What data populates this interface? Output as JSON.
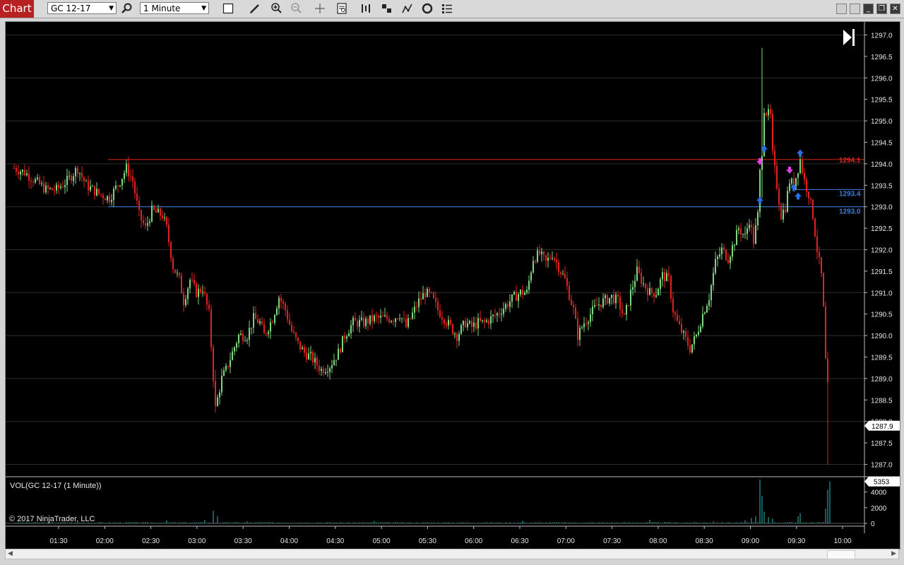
{
  "toolbar": {
    "title": "Chart",
    "instrument": "GC 12-17",
    "interval": "1 Minute",
    "icons": [
      "search-icon",
      "chart-style-icon",
      "pencil-icon",
      "zoom-in-icon",
      "zoom-out-icon",
      "crosshair-icon",
      "data-box-icon",
      "bar-spacing-icon",
      "bar-width-icon",
      "indicators-icon",
      "strategies-icon",
      "properties-icon"
    ]
  },
  "colors": {
    "up": "#7ed67e",
    "down": "#e0231e",
    "accent": "#b72121",
    "level_red": "#e0231e",
    "level_blue": "#3a7ee0",
    "volume": "#2fb7b7"
  },
  "chart_data": {
    "type": "candlestick",
    "instrument": "GC 12-17",
    "interval": "1 Minute",
    "y_ticks": [
      1297.0,
      1296.5,
      1296.0,
      1295.5,
      1295.0,
      1294.5,
      1294.0,
      1293.5,
      1293.0,
      1292.5,
      1292.0,
      1291.5,
      1291.0,
      1290.5,
      1290.0,
      1289.5,
      1289.0,
      1288.5,
      1288.0,
      1287.5,
      1287.0
    ],
    "ylim": [
      1286.85,
      1297.2
    ],
    "x_labels": [
      "01:30",
      "02:00",
      "02:30",
      "03:00",
      "03:30",
      "04:00",
      "04:30",
      "05:00",
      "05:30",
      "06:00",
      "06:30",
      "07:00",
      "07:30",
      "08:00",
      "08:30",
      "09:00",
      "09:30",
      "10:00"
    ],
    "last_price": "1287.9",
    "levels": [
      {
        "label": "1294.1",
        "value": 1294.1,
        "color": "red"
      },
      {
        "label": "1293.4",
        "value": 1293.4,
        "color": "blue"
      },
      {
        "label": "1293.0",
        "value": 1293.0,
        "color": "blue"
      }
    ],
    "path": [
      [
        0,
        1293.9
      ],
      [
        5,
        1293.8
      ],
      [
        10,
        1293.6
      ],
      [
        15,
        1293.4
      ],
      [
        20,
        1293.4
      ],
      [
        25,
        1293.6
      ],
      [
        30,
        1293.9
      ],
      [
        34,
        1293.5
      ],
      [
        40,
        1293.3
      ],
      [
        45,
        1293.2
      ],
      [
        50,
        1293.6
      ],
      [
        53,
        1293.9
      ],
      [
        56,
        1293.6
      ],
      [
        59,
        1292.8
      ],
      [
        62,
        1292.5
      ],
      [
        65,
        1292.9
      ],
      [
        70,
        1292.8
      ],
      [
        72,
        1292.5
      ],
      [
        75,
        1291.6
      ],
      [
        78,
        1291.3
      ],
      [
        80,
        1290.8
      ],
      [
        83,
        1291.3
      ],
      [
        86,
        1291.0
      ],
      [
        89,
        1291.1
      ],
      [
        92,
        1290.5
      ],
      [
        95,
        1288.3
      ],
      [
        98,
        1289.0
      ],
      [
        100,
        1289.2
      ],
      [
        103,
        1289.6
      ],
      [
        106,
        1290.0
      ],
      [
        110,
        1290.0
      ],
      [
        113,
        1290.4
      ],
      [
        116,
        1290.3
      ],
      [
        118,
        1290.0
      ],
      [
        122,
        1290.4
      ],
      [
        125,
        1290.9
      ],
      [
        128,
        1290.6
      ],
      [
        131,
        1290.1
      ],
      [
        134,
        1289.8
      ],
      [
        137,
        1289.6
      ],
      [
        140,
        1289.5
      ],
      [
        145,
        1289.2
      ],
      [
        149,
        1289.3
      ],
      [
        153,
        1289.6
      ],
      [
        156,
        1290.0
      ],
      [
        160,
        1290.3
      ],
      [
        165,
        1290.3
      ],
      [
        170,
        1290.4
      ],
      [
        175,
        1290.4
      ],
      [
        179,
        1290.4
      ],
      [
        182,
        1290.5
      ],
      [
        185,
        1290.2
      ],
      [
        188,
        1290.5
      ],
      [
        191,
        1290.8
      ],
      [
        194,
        1291.0
      ],
      [
        197,
        1290.9
      ],
      [
        200,
        1290.6
      ],
      [
        203,
        1290.4
      ],
      [
        206,
        1290.2
      ],
      [
        209,
        1290.0
      ],
      [
        213,
        1290.3
      ],
      [
        216,
        1290.2
      ],
      [
        219,
        1290.3
      ],
      [
        222,
        1290.3
      ],
      [
        225,
        1290.4
      ],
      [
        228,
        1290.5
      ],
      [
        232,
        1290.7
      ],
      [
        236,
        1290.9
      ],
      [
        239,
        1291.0
      ],
      [
        242,
        1291.0
      ],
      [
        245,
        1291.8
      ],
      [
        248,
        1291.9
      ],
      [
        251,
        1291.7
      ],
      [
        254,
        1291.9
      ],
      [
        257,
        1291.6
      ],
      [
        260,
        1291.3
      ],
      [
        264,
        1290.6
      ],
      [
        266,
        1290.0
      ],
      [
        269,
        1290.3
      ],
      [
        272,
        1290.5
      ],
      [
        275,
        1290.7
      ],
      [
        278,
        1290.8
      ],
      [
        282,
        1290.9
      ],
      [
        285,
        1290.8
      ],
      [
        288,
        1290.4
      ],
      [
        291,
        1291.0
      ],
      [
        294,
        1291.5
      ],
      [
        297,
        1291.2
      ],
      [
        300,
        1291.0
      ],
      [
        303,
        1291.0
      ],
      [
        306,
        1291.4
      ],
      [
        309,
        1291.3
      ],
      [
        311,
        1290.6
      ],
      [
        313,
        1290.3
      ],
      [
        316,
        1290.0
      ],
      [
        319,
        1289.7
      ],
      [
        322,
        1290.0
      ],
      [
        325,
        1290.5
      ],
      [
        328,
        1290.9
      ],
      [
        331,
        1291.7
      ],
      [
        334,
        1292.0
      ],
      [
        337,
        1291.8
      ],
      [
        340,
        1292.2
      ],
      [
        342,
        1292.5
      ],
      [
        345,
        1292.3
      ],
      [
        347,
        1292.7
      ],
      [
        349,
        1292.2
      ],
      [
        351,
        1292.8
      ],
      [
        352,
        1293.8
      ],
      [
        353,
        1294.3
      ],
      [
        354,
        1295.3
      ],
      [
        355,
        1295.2
      ],
      [
        357,
        1295.1
      ],
      [
        358,
        1294.2
      ],
      [
        360,
        1293.5
      ],
      [
        362,
        1292.8
      ],
      [
        364,
        1293.0
      ],
      [
        366,
        1293.6
      ],
      [
        368,
        1293.5
      ],
      [
        370,
        1293.9
      ],
      [
        371,
        1294.1
      ],
      [
        373,
        1293.6
      ],
      [
        375,
        1293.3
      ],
      [
        377,
        1292.8
      ],
      [
        379,
        1292.0
      ],
      [
        381,
        1291.4
      ],
      [
        382,
        1290.6
      ],
      [
        383,
        1289.4
      ],
      [
        384,
        1288.8
      ],
      [
        385,
        1287.9
      ]
    ],
    "volume": {
      "label": "VOL(GC 12-17 (1 Minute))",
      "last": "5353",
      "ticks": [
        "4000",
        "2000",
        "0"
      ],
      "ylim": [
        0,
        5600
      ],
      "spikes": [
        [
          72,
          380
        ],
        [
          90,
          420
        ],
        [
          94,
          1600
        ],
        [
          96,
          900
        ],
        [
          110,
          260
        ],
        [
          170,
          300
        ],
        [
          240,
          330
        ],
        [
          300,
          450
        ],
        [
          330,
          260
        ],
        [
          345,
          400
        ],
        [
          348,
          700
        ],
        [
          350,
          900
        ],
        [
          352,
          5600
        ],
        [
          353,
          3500
        ],
        [
          354,
          1500
        ],
        [
          356,
          800
        ],
        [
          358,
          600
        ],
        [
          370,
          900
        ],
        [
          371,
          1300
        ],
        [
          383,
          1900
        ],
        [
          384,
          4300
        ],
        [
          385,
          5353
        ]
      ]
    }
  },
  "copyright": "© 2017 NinjaTrader, LLC"
}
